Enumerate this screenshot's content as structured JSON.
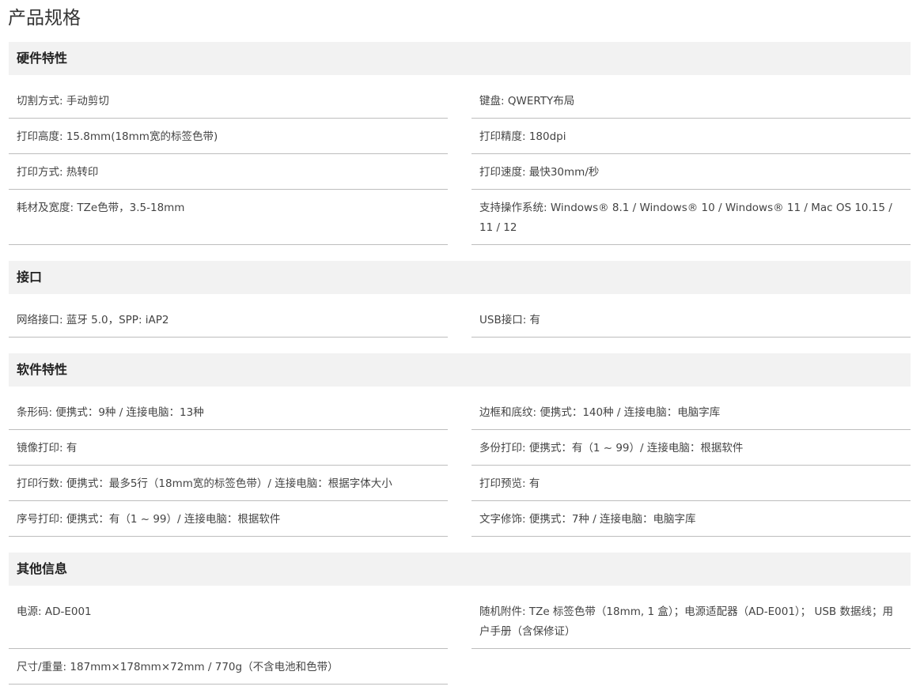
{
  "page_title": "产品规格",
  "sections": {
    "hardware": {
      "title": "硬件特性",
      "items": [
        "切割方式: 手动剪切",
        "键盘: QWERTY布局",
        "打印高度: 15.8mm(18mm宽的标签色带)",
        "打印精度: 180dpi",
        "打印方式: 热转印",
        "打印速度: 最快30mm/秒",
        "耗材及宽度: TZe色带，3.5-18mm",
        "支持操作系统: Windows® 8.1 / Windows® 10 / Windows® 11 / Mac OS 10.15 / 11 / 12"
      ]
    },
    "interface": {
      "title": "接口",
      "items": [
        "网络接口: 蓝牙 5.0，SPP: iAP2",
        "USB接口: 有"
      ]
    },
    "software": {
      "title": "软件特性",
      "items": [
        "条形码: 便携式：9种 / 连接电脑：13种",
        "边框和底纹: 便携式：140种 / 连接电脑：电脑字库",
        "镜像打印: 有",
        "多份打印: 便携式：有（1 ~ 99）/ 连接电脑：根据软件",
        "打印行数: 便携式：最多5行（18mm宽的标签色带）/ 连接电脑：根据字体大小",
        "打印预览: 有",
        "序号打印: 便携式：有（1 ~ 99）/ 连接电脑：根据软件",
        "文字修饰: 便携式：7种 / 连接电脑：电脑字库"
      ]
    },
    "other": {
      "title": "其他信息",
      "items": [
        "电源: AD-E001",
        "随机附件: TZe 标签色带（18mm, 1 盒）；电源适配器（AD-E001）； USB 数据线；用户手册（含保修证）",
        "尺寸/重量: 187mm×178mm×72mm / 770g（不含电池和色带）"
      ]
    }
  }
}
